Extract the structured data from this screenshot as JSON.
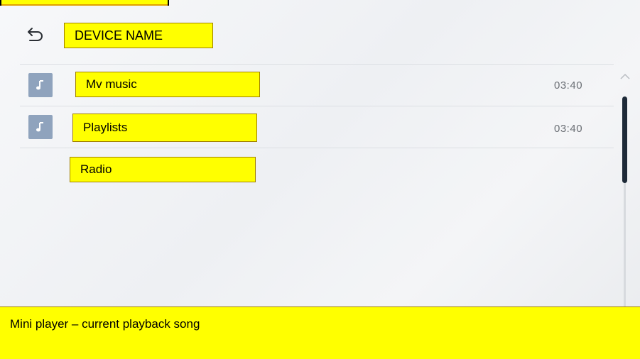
{
  "header": {
    "device_name": "DEVICE NAME"
  },
  "list": {
    "items": [
      {
        "label": "Mv music",
        "duration": "03:40",
        "icon": "music-note-icon"
      },
      {
        "label": "Playlists",
        "duration": "03:40",
        "icon": "music-note-icon"
      },
      {
        "label": "Radio",
        "duration": "",
        "icon": ""
      }
    ]
  },
  "mini_player": {
    "label": "Mini player – current playback song"
  },
  "colors": {
    "annotation_yellow": "#ffff00",
    "icon_tile": "#8fa3bd",
    "scroll_thumb": "#1e2a38",
    "duration_text": "#6b6f75"
  }
}
